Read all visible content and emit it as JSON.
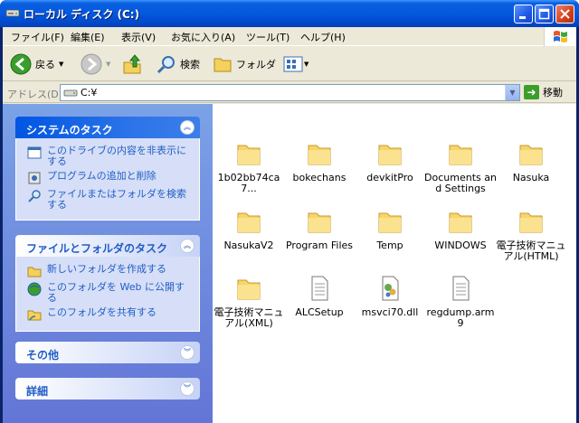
{
  "window": {
    "title": "ローカル ディスク (C:)",
    "buttons": [
      "minimize",
      "maximize",
      "close"
    ]
  },
  "menu": [
    "ファイル(F)",
    "編集(E)",
    "表示(V)",
    "お気に入り(A)",
    "ツール(T)",
    "ヘルプ(H)"
  ],
  "toolbar": {
    "back_label": "戻る",
    "search_label": "検索",
    "folders_label": "フォルダ"
  },
  "address": {
    "label": "アドレス(D)",
    "value": "C:¥",
    "go_label": "移動"
  },
  "tasks": {
    "system": {
      "title": "システムのタスク",
      "items": [
        "このドライブの内容を非表示にする",
        "プログラムの追加と削除",
        "ファイルまたはフォルダを検索する"
      ]
    },
    "file_folder": {
      "title": "ファイルとフォルダのタスク",
      "items": [
        "新しいフォルダを作成する",
        "このフォルダを Web に公開する",
        "このフォルダを共有する"
      ]
    },
    "other": {
      "title": "その他"
    },
    "details": {
      "title": "詳細"
    }
  },
  "files": [
    {
      "name": "1b02bb74ca7...",
      "type": "folder"
    },
    {
      "name": "bokechans",
      "type": "folder"
    },
    {
      "name": "devkitPro",
      "type": "folder"
    },
    {
      "name": "Documents and Settings",
      "type": "folder"
    },
    {
      "name": "Nasuka",
      "type": "folder"
    },
    {
      "name": "NasukaV2",
      "type": "folder"
    },
    {
      "name": "Program Files",
      "type": "folder"
    },
    {
      "name": "Temp",
      "type": "folder"
    },
    {
      "name": "WINDOWS",
      "type": "folder"
    },
    {
      "name": "電子技術マニュアル(HTML)",
      "type": "folder"
    },
    {
      "name": "電子技術マニュアル(XML)",
      "type": "folder"
    },
    {
      "name": "ALCSetup",
      "type": "text-file"
    },
    {
      "name": "msvci70.dll",
      "type": "dll-file"
    },
    {
      "name": "regdump.arm9",
      "type": "text-file"
    }
  ],
  "colors": {
    "titlebar": "#0458dc",
    "taskpane": "#7ba2e7",
    "link": "#215dc6"
  }
}
